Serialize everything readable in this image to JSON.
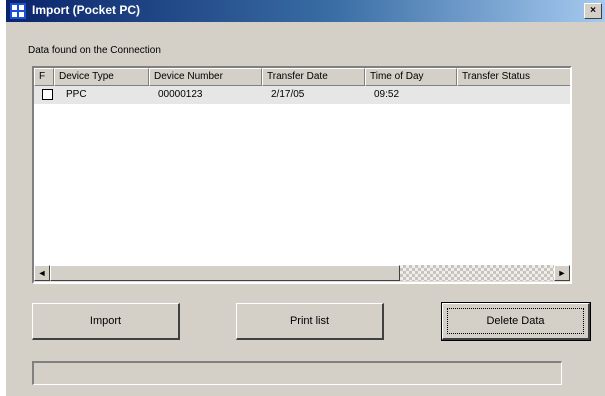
{
  "window": {
    "title": "Import (Pocket PC)",
    "close_label": "×"
  },
  "list_caption": "Data found on the Connection",
  "columns": [
    "F",
    "Device Type",
    "Device Number",
    "Transfer Date",
    "Time of Day",
    "Transfer Status"
  ],
  "rows": [
    {
      "checked": false,
      "device_type": "PPC",
      "device_number": "00000123",
      "transfer_date": "2/17/05",
      "time_of_day": "09:52",
      "transfer_status": ""
    }
  ],
  "scroll": {
    "left": "◄",
    "right": "►"
  },
  "buttons": {
    "import": "Import",
    "print_list": "Print list",
    "delete_data": "Delete Data"
  },
  "progress": 0
}
